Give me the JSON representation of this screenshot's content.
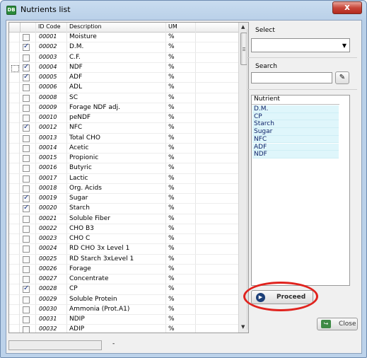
{
  "window": {
    "title": "Nutrients list",
    "icon_text": "DB",
    "close_glyph": "x"
  },
  "grid": {
    "columns": [
      "ID Code",
      "Description",
      "UM"
    ],
    "rows": [
      {
        "id": "00001",
        "desc": "Moisture",
        "um": "%",
        "checked": false
      },
      {
        "id": "00002",
        "desc": "D.M.",
        "um": "%",
        "checked": true
      },
      {
        "id": "00003",
        "desc": "C.F.",
        "um": "%",
        "checked": false
      },
      {
        "id": "00004",
        "desc": "NDF",
        "um": "%",
        "checked": true
      },
      {
        "id": "00005",
        "desc": "ADF",
        "um": "%",
        "checked": true
      },
      {
        "id": "00006",
        "desc": "ADL",
        "um": "%",
        "checked": false
      },
      {
        "id": "00008",
        "desc": "SC",
        "um": "%",
        "checked": false
      },
      {
        "id": "00009",
        "desc": "Forage NDF adj.",
        "um": "%",
        "checked": false
      },
      {
        "id": "00010",
        "desc": "peNDF",
        "um": "%",
        "checked": false
      },
      {
        "id": "00012",
        "desc": "NFC",
        "um": "%",
        "checked": true
      },
      {
        "id": "00013",
        "desc": "Total CHO",
        "um": "%",
        "checked": false
      },
      {
        "id": "00014",
        "desc": "Acetic",
        "um": "%",
        "checked": false
      },
      {
        "id": "00015",
        "desc": "Propionic",
        "um": "%",
        "checked": false
      },
      {
        "id": "00016",
        "desc": "Butyric",
        "um": "%",
        "checked": false
      },
      {
        "id": "00017",
        "desc": "Lactic",
        "um": "%",
        "checked": false
      },
      {
        "id": "00018",
        "desc": "Org. Acids",
        "um": "%",
        "checked": false
      },
      {
        "id": "00019",
        "desc": "Sugar",
        "um": "%",
        "checked": true
      },
      {
        "id": "00020",
        "desc": "Starch",
        "um": "%",
        "checked": true
      },
      {
        "id": "00021",
        "desc": "Soluble Fiber",
        "um": "%",
        "checked": false
      },
      {
        "id": "00022",
        "desc": "CHO B3",
        "um": "%",
        "checked": false
      },
      {
        "id": "00023",
        "desc": "CHO C",
        "um": "%",
        "checked": false
      },
      {
        "id": "00024",
        "desc": "RD CHO 3x Level 1",
        "um": "%",
        "checked": false
      },
      {
        "id": "00025",
        "desc": "RD Starch 3xLevel 1",
        "um": "%",
        "checked": false
      },
      {
        "id": "00026",
        "desc": "Forage",
        "um": "%",
        "checked": false
      },
      {
        "id": "00027",
        "desc": "Concentrate",
        "um": "%",
        "checked": false
      },
      {
        "id": "00028",
        "desc": "CP",
        "um": "%",
        "checked": true
      },
      {
        "id": "00029",
        "desc": "Soluble Protein",
        "um": "%",
        "checked": false
      },
      {
        "id": "00030",
        "desc": "Ammonia (Prot.A1)",
        "um": "%",
        "checked": false
      },
      {
        "id": "00031",
        "desc": "NDIP",
        "um": "%",
        "checked": false
      },
      {
        "id": "00032",
        "desc": "ADIP",
        "um": "%",
        "checked": false
      }
    ]
  },
  "select": {
    "label": "Select",
    "value": ""
  },
  "search": {
    "label": "Search",
    "value": "",
    "button_glyph": "✎"
  },
  "nutrient_list": {
    "header": "Nutrient",
    "items": [
      "D.M.",
      "CP",
      "Starch",
      "Sugar",
      "NFC",
      "ADF",
      "NDF"
    ]
  },
  "buttons": {
    "proceed": "Proceed",
    "close": "Close",
    "proceed_glyph": "▶",
    "close_glyph": "↪"
  },
  "statusbar": {
    "text": "-"
  },
  "colors": {
    "highlight": "#e0231e",
    "list_item_bg": "#dff6fb",
    "check": "#1e3a8c"
  }
}
